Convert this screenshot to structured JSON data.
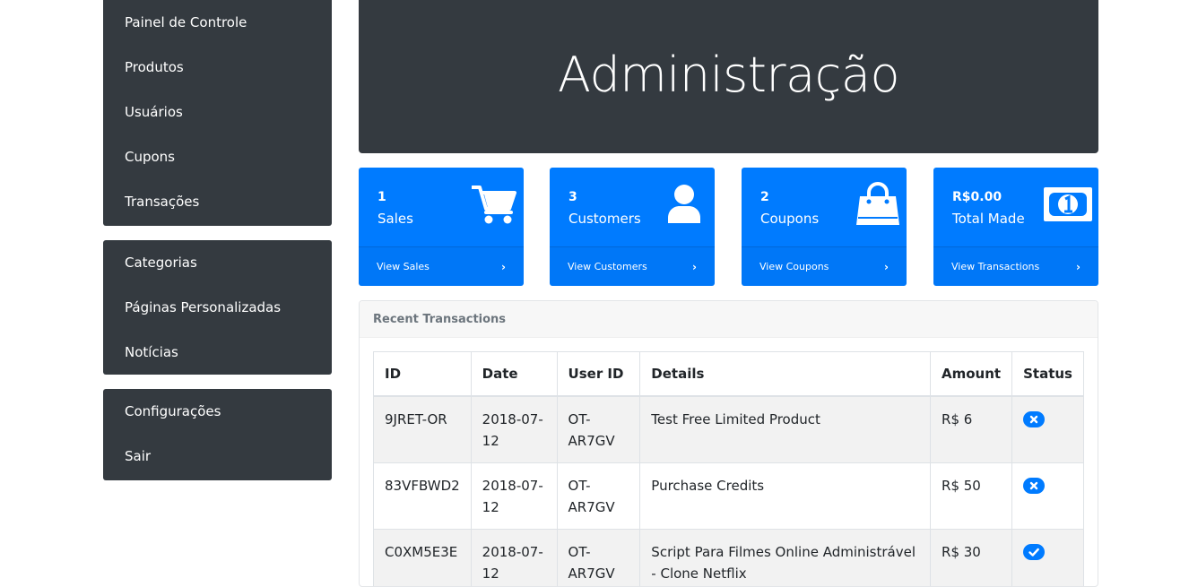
{
  "sidebar": {
    "groups": [
      {
        "items": [
          {
            "label": "Painel de Controle"
          },
          {
            "label": "Produtos"
          },
          {
            "label": "Usuários"
          },
          {
            "label": "Cupons"
          },
          {
            "label": "Transações"
          }
        ]
      },
      {
        "items": [
          {
            "label": "Categorias"
          },
          {
            "label": "Páginas Personalizadas"
          },
          {
            "label": "Notícias"
          }
        ]
      },
      {
        "items": [
          {
            "label": "Configurações"
          },
          {
            "label": "Sair"
          }
        ]
      }
    ]
  },
  "hero": {
    "title": "Administração"
  },
  "cards": [
    {
      "count": "1",
      "label": "Sales",
      "link": "View Sales",
      "icon": "cart-icon"
    },
    {
      "count": "3",
      "label": "Customers",
      "link": "View Customers",
      "icon": "user-icon"
    },
    {
      "count": "2",
      "label": "Coupons",
      "link": "View Coupons",
      "icon": "shopping-bag-icon"
    },
    {
      "count": "R$0.00",
      "label": "Total Made",
      "link": "View Transactions",
      "icon": "money-bill-icon"
    }
  ],
  "transactions": {
    "title": "Recent Transactions",
    "columns": [
      "ID",
      "Date",
      "User ID",
      "Details",
      "Amount",
      "Status"
    ],
    "rows": [
      {
        "id": "9JRET-OR",
        "date": "2018-07-12",
        "user": "OT-AR7GV",
        "details": "Test Free Limited Product",
        "amount": "R$ 6",
        "status": "x-circle-icon"
      },
      {
        "id": "83VFBWD2",
        "date": "2018-07-12",
        "user": "OT-AR7GV",
        "details": "Purchase Credits",
        "amount": "R$ 50",
        "status": "x-circle-icon"
      },
      {
        "id": "C0XM5E3E",
        "date": "2018-07-12",
        "user": "OT-AR7GV",
        "details": "Script Para Filmes Online Administrável - Clone Netflix",
        "amount": "R$ 30",
        "status": "check-circle-icon"
      }
    ]
  },
  "colors": {
    "dark": "#343a40",
    "primary": "#007bff"
  }
}
